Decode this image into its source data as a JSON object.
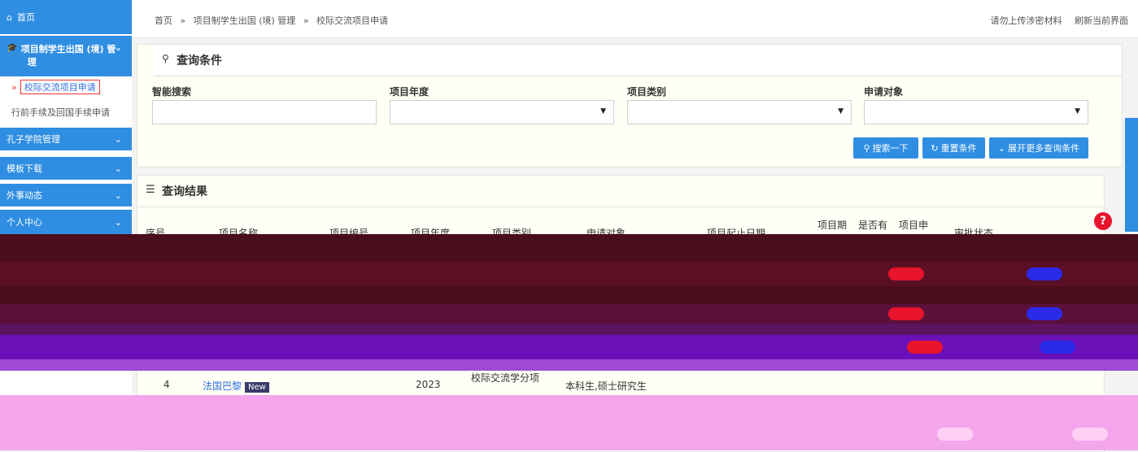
{
  "sidebar": {
    "home": "首页",
    "group": "项目制学生出国 (境) 管",
    "group_line2": "理",
    "active_item": "校际交流项目申请",
    "item2": "行前手续及回国手续申请",
    "items": [
      "孔子学院管理",
      "模板下载",
      "外事动态",
      "个人中心"
    ]
  },
  "breadcrumb": [
    "首页",
    "»",
    "项目制学生出国 (境) 管理",
    "»",
    "校际交流项目申请"
  ],
  "top_links": [
    "请勿上传涉密材料",
    "刷新当前界面"
  ],
  "query": {
    "title": "查询条件",
    "labels": [
      "智能搜索",
      "项目年度",
      "项目类别",
      "申请对象"
    ],
    "buttons": [
      "搜索一下",
      "重置条件",
      "展开更多查询条件"
    ]
  },
  "results": {
    "title": "查询结果",
    "headers": [
      "序号",
      "项目名称",
      "项目编号",
      "项目年度",
      "项目类别",
      "申请对象",
      "项目起止日期",
      "项目期限",
      "是否有效",
      "项目申",
      "审批状态"
    ],
    "row4": {
      "index": "4",
      "name": "法国巴黎",
      "tag": "New",
      "year": "2023",
      "category": "校际交流学分项",
      "target": "本科生,硕士研究生"
    }
  },
  "colors": {
    "accent": "#2f8ee2",
    "band_dark": "#4a0d1c",
    "band_purple": "#6a10b8",
    "band_pink": "#f4a6ec"
  }
}
